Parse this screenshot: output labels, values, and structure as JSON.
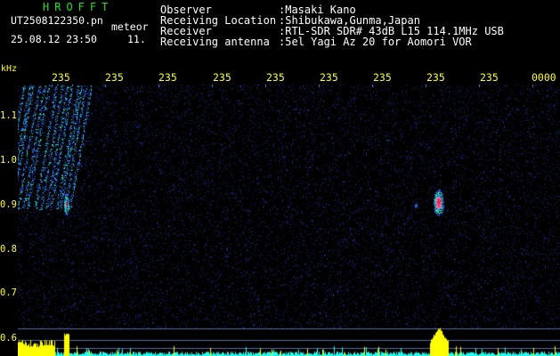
{
  "header": {
    "logo": "HROFFT",
    "file_name": "UT2508122350.pn",
    "meteor_label": "meteor",
    "timestamp": "25.08.12 23:50",
    "count": "11."
  },
  "metadata": [
    {
      "label": "Observer",
      "value": ":Masaki Kano"
    },
    {
      "label": "Receiving Location",
      "value": ":Shibukawa,Gunma,Japan"
    },
    {
      "label": "Receiver",
      "value": ":RTL-SDR SDR# 43dB L15 114.1MHz USB"
    },
    {
      "label": "Receiving antenna",
      "value": ":5el Yagi Az 20 for Aomori VOR"
    }
  ],
  "time_axis": {
    "labels": [
      "235",
      "235",
      "235",
      "235",
      "235",
      "235",
      "235",
      "235",
      "235",
      "0000"
    ]
  },
  "freq_axis": {
    "unit": "kHz",
    "labels": [
      "1.1",
      "1.0",
      "0.9",
      "0.8",
      "0.7",
      "0.6"
    ]
  },
  "colors": {
    "background": "#000000",
    "axis_text": "#ffff33",
    "logo": "#20e020",
    "echo_core": "#ff2255",
    "echo_mid": "#20a0ff",
    "echo_outer": "#22ee88",
    "noise": "#1a2a8a",
    "level_bar": "#ffff00",
    "level_base": "#22ffee",
    "tick_marker": "#4488ff"
  }
}
